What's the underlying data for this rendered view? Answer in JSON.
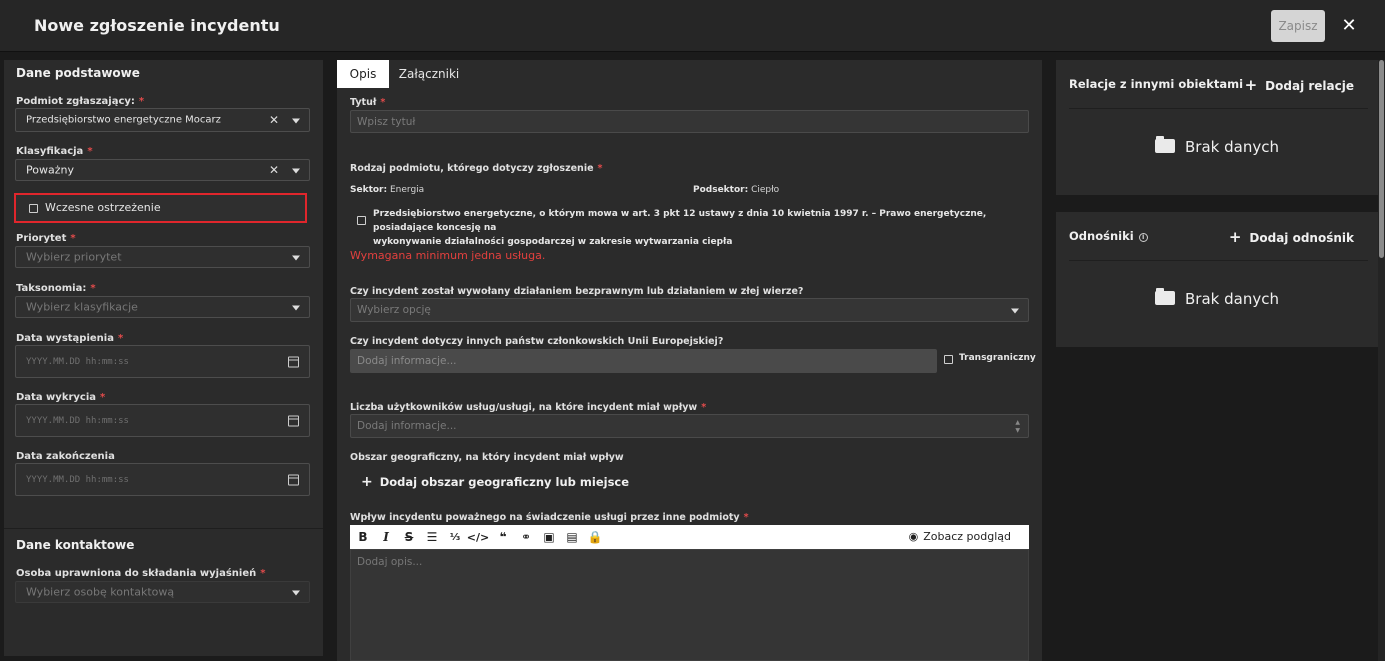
{
  "header": {
    "title": "Nowe zgłoszenie incydentu",
    "save_label": "Zapisz",
    "close_glyph": "✕"
  },
  "left": {
    "section_basic": "Dane podstawowe",
    "podmiot_label": "Podmiot zgłaszający:",
    "podmiot_value": "Przedsiębiorstwo energetyczne Mocarz",
    "klasyfikacja_label": "Klasyfikacja",
    "klasyfikacja_value": "Poważny",
    "early_warning_label": "Wczesne ostrzeżenie",
    "priorytet_label": "Priorytet",
    "priorytet_placeholder": "Wybierz priorytet",
    "taksonomia_label": "Taksonomia:",
    "taksonomia_placeholder": "Wybierz klasyfikacje",
    "data_wystapienia_label": "Data wystąpienia",
    "data_wykrycia_label": "Data wykrycia",
    "data_zakonczenia_label": "Data zakończenia",
    "date_placeholder": "YYYY.MM.DD hh:mm:ss",
    "section_contact": "Dane kontaktowe",
    "osoba_label": "Osoba uprawniona do składania wyjaśnień",
    "osoba_placeholder": "Wybierz osobę kontaktową",
    "required_mark": "*"
  },
  "main": {
    "tabs": [
      {
        "label": "Opis",
        "active": true
      },
      {
        "label": "Załączniki",
        "active": false
      }
    ],
    "tytul_label": "Tytuł",
    "tytul_placeholder": "Wpisz tytuł",
    "rodzaj_label": "Rodzaj podmiotu, którego dotyczy zgłoszenie",
    "sektor_key": "Sektor:",
    "sektor_value": "Energia",
    "podsektor_key": "Podsektor:",
    "podsektor_value": "Ciepło",
    "service_text_line1": "Przedsiębiorstwo energetyczne, o którym mowa w art. 3 pkt 12 ustawy z dnia 10 kwietnia 1997 r. – Prawo energetyczne, posiadające koncesję na",
    "service_text_line2": "wykonywanie działalności gospodarczej w zakresie wytwarzania ciepła",
    "error_text": "Wymagana minimum jedna usługa.",
    "q1_label": "Czy incydent został wywołany działaniem bezprawnym lub działaniem w złej wierze?",
    "q1_placeholder": "Wybierz opcję",
    "q2_label": "Czy incydent dotyczy innych państw członkowskich Unii Europejskiej?",
    "q2_placeholder": "Dodaj informacje...",
    "transgraniczny_label": "Transgraniczny",
    "users_label": "Liczba użytkowników usług/usługi, na które incydent miał wpływ",
    "users_placeholder": "Dodaj informacje...",
    "geo_label": "Obszar geograficzny, na który incydent miał wpływ",
    "geo_add": "Dodaj obszar geograficzny lub miejsce",
    "impact_label": "Wpływ incydentu poważnego na świadczenie usługi przez inne podmioty",
    "preview_label": "Zobacz podgląd",
    "editor_placeholder": "Dodaj opis...",
    "toolbar_icons": [
      "bold-icon",
      "italic-icon",
      "strikethrough-icon",
      "bullet-list-icon",
      "numbered-list-icon",
      "code-icon",
      "quote-icon",
      "link-icon",
      "image-icon",
      "file-icon",
      "lock-icon"
    ]
  },
  "right": {
    "relations_title": "Relacje z innymi obiektami",
    "relations_add": "Dodaj relacje",
    "links_title": "Odnośniki",
    "links_add": "Dodaj odnośnik",
    "empty_text": "Brak danych"
  }
}
